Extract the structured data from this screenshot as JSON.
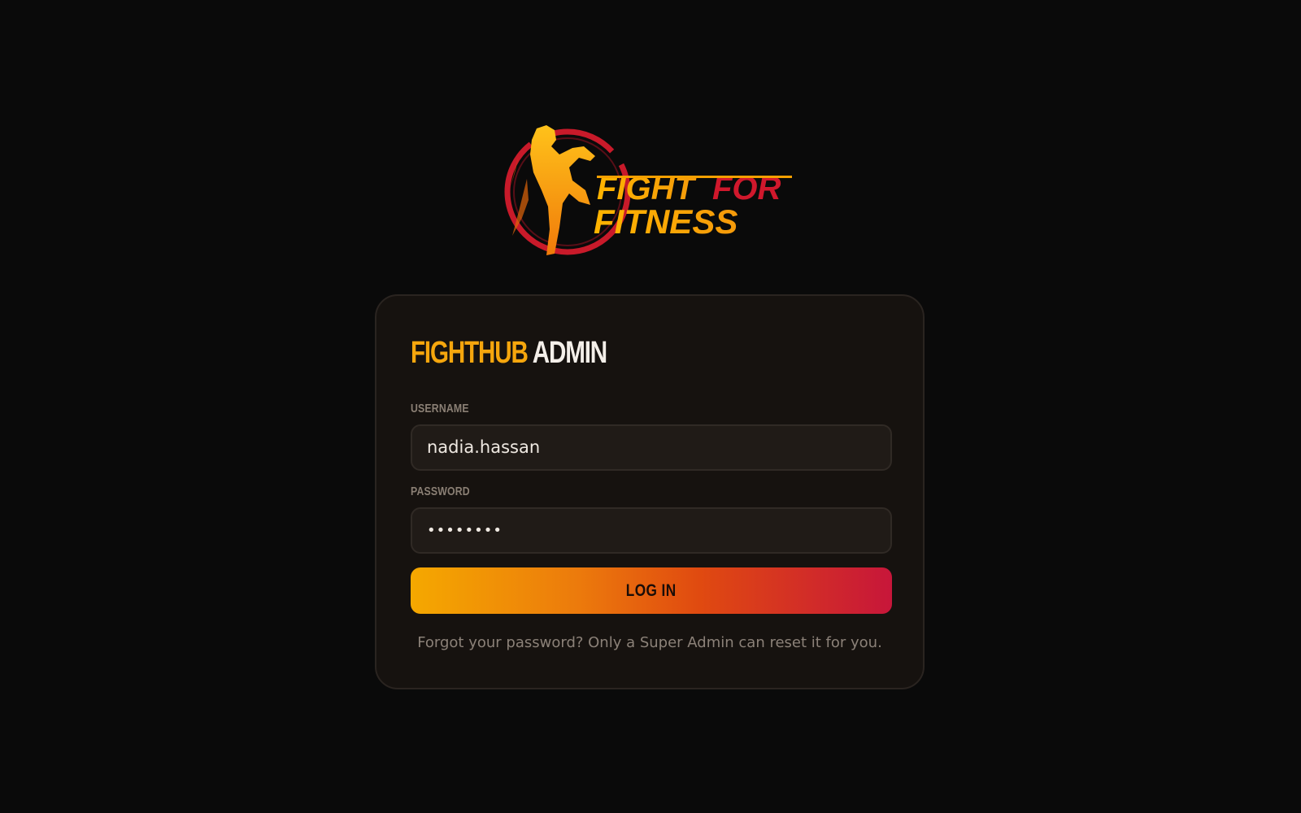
{
  "brand": {
    "logo_line1_a": "FIGHT",
    "logo_line1_b": "FOR",
    "logo_line2": "FITNESS"
  },
  "card": {
    "title_part1": "FIGHTHUB",
    "title_part2": "ADMIN",
    "username_label": "USERNAME",
    "username_value": "nadia.hassan",
    "password_label": "PASSWORD",
    "password_value": "••••••••",
    "login_label": "LOG IN",
    "helper_text": "Forgot your password? Only a Super Admin can reset it for you."
  },
  "colors": {
    "background": "#0a0a0a",
    "card": "#16120f",
    "accent_gold": "#f5a60d",
    "accent_red": "#c7163a"
  },
  "icons": {
    "logo": "fighter-silhouette-icon"
  }
}
